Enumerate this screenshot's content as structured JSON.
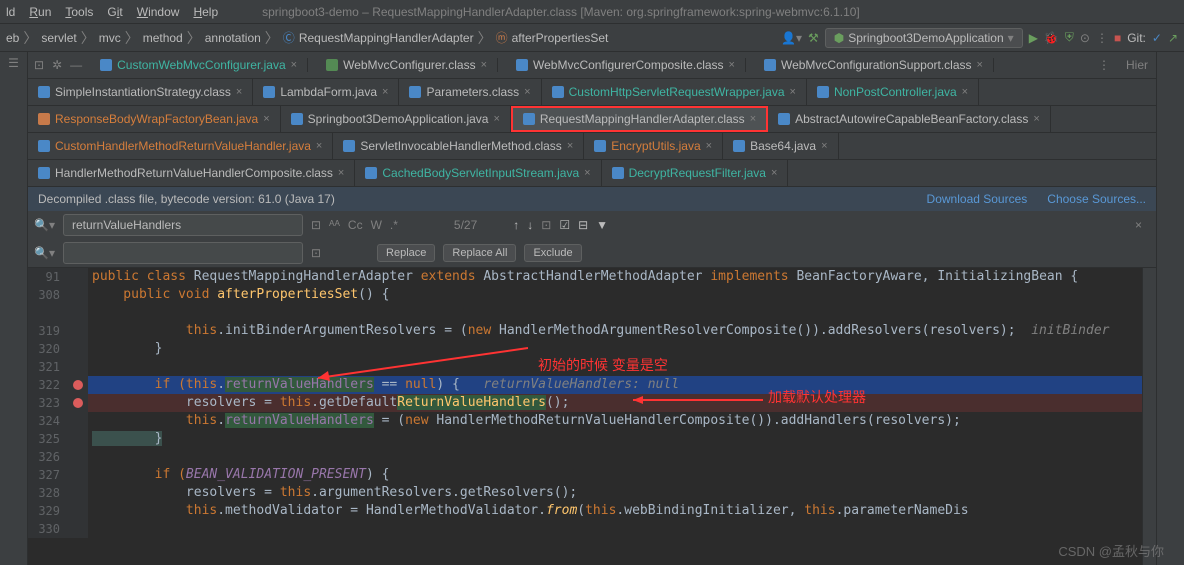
{
  "menu": {
    "items": [
      "ld",
      "Run",
      "Tools",
      "Git",
      "Window",
      "Help"
    ],
    "title": "springboot3-demo – RequestMappingHandlerAdapter.class [Maven: org.springframework:spring-webmvc:6.1.10]"
  },
  "breadcrumb": [
    "eb",
    "servlet",
    "mvc",
    "method",
    "annotation",
    "RequestMappingHandlerAdapter",
    "afterPropertiesSet"
  ],
  "run_config": "Springboot3DemoApplication",
  "git_label": "Git:",
  "tabs_row1": [
    {
      "label": "CustomWebMvcConfigurer.java",
      "color": "teal"
    },
    {
      "label": "WebMvcConfigurer.class",
      "color": ""
    },
    {
      "label": "WebMvcConfigurerComposite.class",
      "color": ""
    },
    {
      "label": "WebMvcConfigurationSupport.class",
      "color": ""
    }
  ],
  "tabs_row2": [
    {
      "label": "SimpleInstantiationStrategy.class",
      "color": ""
    },
    {
      "label": "LambdaForm.java",
      "color": ""
    },
    {
      "label": "Parameters.class",
      "color": ""
    },
    {
      "label": "CustomHttpServletRequestWrapper.java",
      "color": "teal"
    },
    {
      "label": "NonPostController.java",
      "color": "teal"
    }
  ],
  "tabs_row3": [
    {
      "label": "ResponseBodyWrapFactoryBean.java",
      "color": "orange"
    },
    {
      "label": "Springboot3DemoApplication.java",
      "color": ""
    },
    {
      "label": "RequestMappingHandlerAdapter.class",
      "color": "",
      "hl": true
    },
    {
      "label": "AbstractAutowireCapableBeanFactory.class",
      "color": ""
    }
  ],
  "tabs_row4": [
    {
      "label": "CustomHandlerMethodReturnValueHandler.java",
      "color": "orange"
    },
    {
      "label": "ServletInvocableHandlerMethod.class",
      "color": ""
    },
    {
      "label": "EncryptUtils.java",
      "color": "orange"
    },
    {
      "label": "Base64.java",
      "color": ""
    }
  ],
  "tabs_row5": [
    {
      "label": "HandlerMethodReturnValueHandlerComposite.class",
      "color": ""
    },
    {
      "label": "CachedBodyServletInputStream.java",
      "color": "teal"
    },
    {
      "label": "DecryptRequestFilter.java",
      "color": "teal"
    }
  ],
  "decompiled": {
    "text": "Decompiled .class file, bytecode version: 61.0 (Java 17)",
    "link1": "Download Sources",
    "link2": "Choose Sources..."
  },
  "find": {
    "search_value": "returnValueHandlers",
    "count": "5/27",
    "replace_btn": "Replace",
    "replace_all_btn": "Replace All",
    "exclude_btn": "Exclude"
  },
  "annotations": {
    "comment1": "初始的时候 变量是空",
    "comment2": "加载默认处理器"
  },
  "line_numbers": [
    "91",
    "308",
    "",
    "319",
    "320",
    "321",
    "322",
    "323",
    "324",
    "325",
    "326",
    "327",
    "328",
    "329",
    "330"
  ],
  "code": {
    "l91": {
      "p1": "public class ",
      "p2": "RequestMappingHandlerAdapter ",
      "p3": "extends ",
      "p4": "AbstractHandlerMethodAdapter ",
      "p5": "implements ",
      "p6": "BeanFactoryAware",
      "p7": ", ",
      "p8": "InitializingBean { "
    },
    "l308": {
      "p1": "    public void ",
      "p2": "afterPropertiesSet",
      "p3": "() {"
    },
    "l319": {
      "p1": "            this",
      "p2": ".initBinderArgumentResolvers = (",
      "p3": "new ",
      "p4": "HandlerMethodArgumentResolverComposite()).addResolvers(resolvers);  ",
      "p5": "initBinder"
    },
    "l320": {
      "p1": "        }"
    },
    "l322": {
      "p1": "        if (",
      "p2": "this",
      "p3": ".",
      "p4": "returnValueHandlers",
      "p5": " == ",
      "p6": "null",
      "p7": ") {   ",
      "p8": "returnValueHandlers: null"
    },
    "l323": {
      "p1": "            resolvers = ",
      "p2": "this",
      "p3": ".getDefault",
      "p4": "ReturnValueHandlers",
      "p5": "();"
    },
    "l324": {
      "p1": "            this",
      "p2": ".",
      "p3": "returnValueHandlers",
      "p4": " = (",
      "p5": "new ",
      "p6": "HandlerMethodReturnValueHandlerComposite()).addHandlers(resolvers);"
    },
    "l325": {
      "p1": "        }"
    },
    "l327": {
      "p1": "        if (",
      "p2": "BEAN_VALIDATION_PRESENT",
      "p3": ") {"
    },
    "l328": {
      "p1": "            resolvers = ",
      "p2": "this",
      "p3": ".argumentResolvers.getResolvers();"
    },
    "l329": {
      "p1": "            this",
      "p2": ".methodValidator = HandlerMethodValidator.",
      "p3": "from",
      "p4": "(",
      "p5": "this",
      "p6": ".webBindingInitializer, ",
      "p7": "this",
      "p8": ".parameterNameDis"
    }
  },
  "watermark": "CSDN @孟秋与你"
}
